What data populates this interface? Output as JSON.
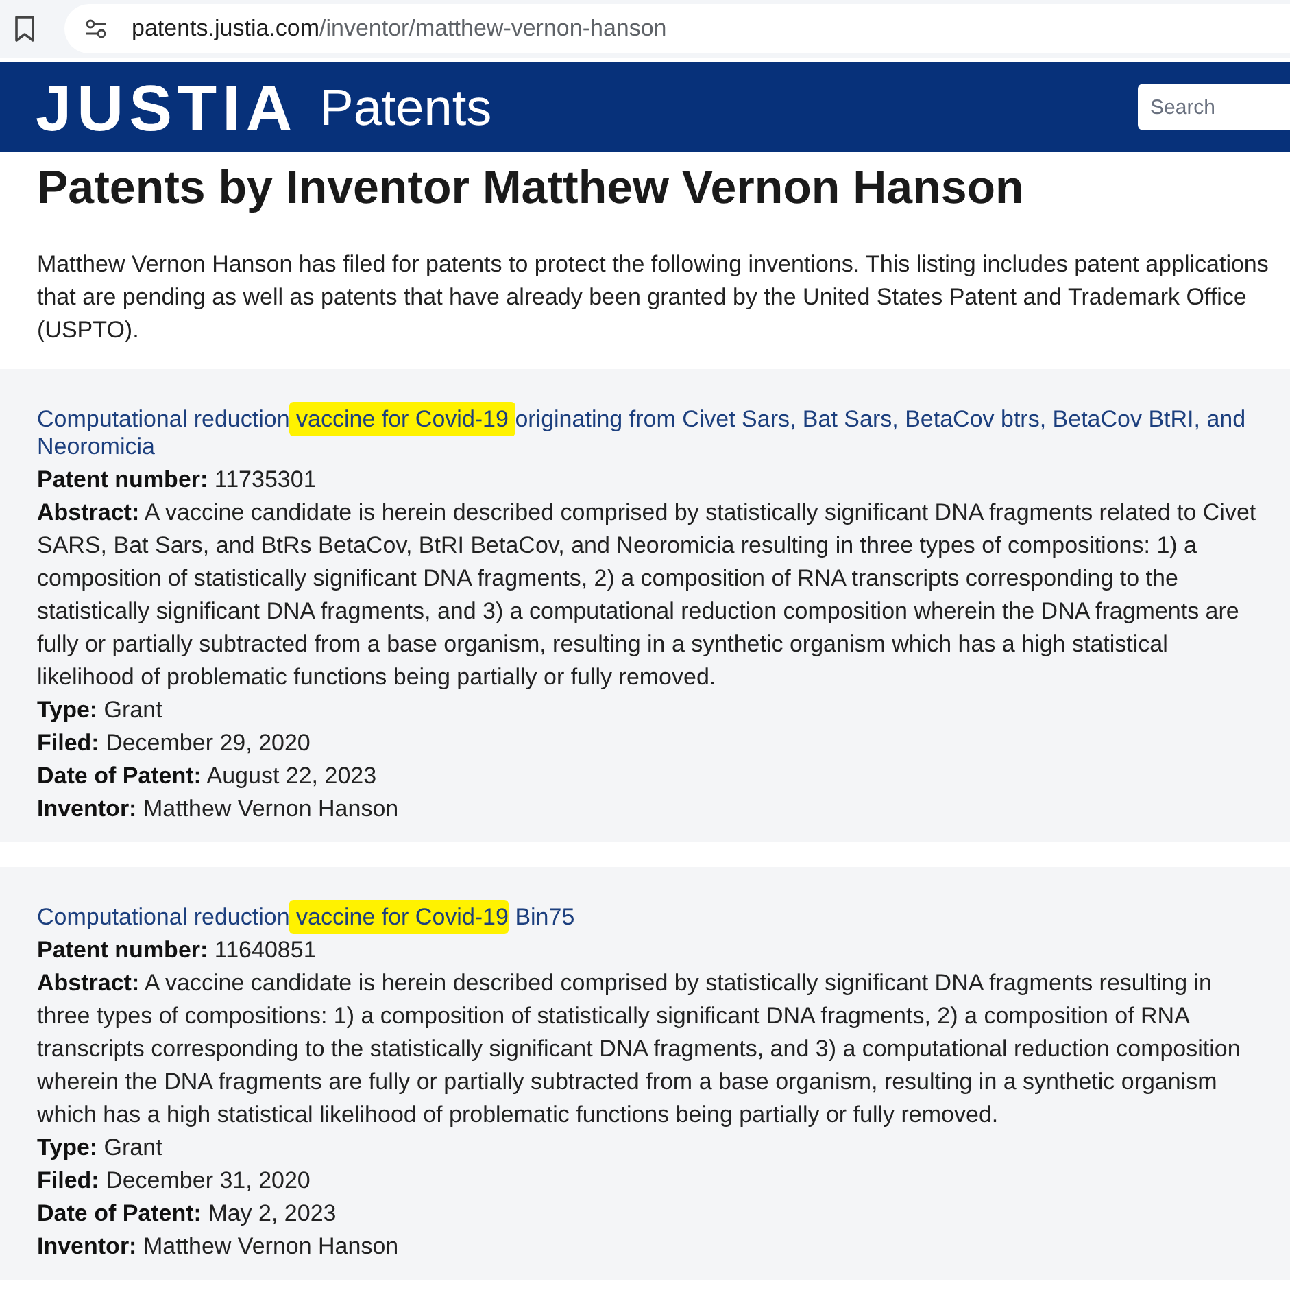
{
  "address_bar": {
    "host": "patents.justia.com",
    "path": "/inventor/matthew-vernon-hanson"
  },
  "header": {
    "logo": "JUSTIA",
    "section": "Patents",
    "search": {
      "placeholder": "Search"
    }
  },
  "page": {
    "title": "Patents by Inventor Matthew Vernon Hanson",
    "intro": "Matthew Vernon Hanson has filed for patents to protect the following inventions. This listing includes patent applications that are pending as well as patents that have already been granted by the United States Patent and Trademark Office (USPTO)."
  },
  "patents": [
    {
      "title": [
        {
          "text": "Computational reduction",
          "highlighted": false
        },
        {
          "text": " vaccine for Covid-19 ",
          "highlighted": true
        },
        {
          "text": "originating from Civet Sars, Bat Sars, BetaCov btrs, BetaCov BtRI, and Neoromicia",
          "highlighted": false
        }
      ],
      "fields": [
        {
          "label": "Patent number:",
          "value": "11735301"
        },
        {
          "label": "Abstract:",
          "value": "A vaccine candidate is herein described comprised by statistically significant DNA fragments related to Civet SARS, Bat Sars, and BtRs BetaCov, BtRI BetaCov, and Neoromicia resulting in three types of compositions: 1) a composition of statistically significant DNA fragments, 2) a composition of RNA transcripts corresponding to the statistically significant DNA fragments, and 3) a computational reduction composition wherein the DNA fragments are fully or partially subtracted from a base organism, resulting in a synthetic organism which has a high statistical likelihood of problematic functions being partially or fully removed."
        },
        {
          "label": "Type:",
          "value": "Grant"
        },
        {
          "label": "Filed:",
          "value": "December 29, 2020"
        },
        {
          "label": "Date of Patent:",
          "value": "August 22, 2023"
        },
        {
          "label": "Inventor:",
          "value": "Matthew Vernon Hanson"
        }
      ]
    },
    {
      "title": [
        {
          "text": "Computational reduction",
          "highlighted": false
        },
        {
          "text": " vaccine for Covid-19",
          "highlighted": true
        },
        {
          "text": " Bin75",
          "highlighted": false
        }
      ],
      "fields": [
        {
          "label": "Patent number:",
          "value": "11640851"
        },
        {
          "label": "Abstract:",
          "value": "A vaccine candidate is herein described comprised by statistically significant DNA fragments resulting in three types of compositions: 1) a composition of statistically significant DNA fragments, 2) a composition of RNA transcripts corresponding to the statistically significant DNA fragments, and 3) a computational reduction composition wherein the DNA fragments are fully or partially subtracted from a base organism, resulting in a synthetic organism which has a high statistical likelihood of problematic functions being partially or fully removed."
        },
        {
          "label": "Type:",
          "value": "Grant"
        },
        {
          "label": "Filed:",
          "value": "December 31, 2020"
        },
        {
          "label": "Date of Patent:",
          "value": "May 2, 2023"
        },
        {
          "label": "Inventor:",
          "value": "Matthew Vernon Hanson"
        }
      ]
    }
  ]
}
